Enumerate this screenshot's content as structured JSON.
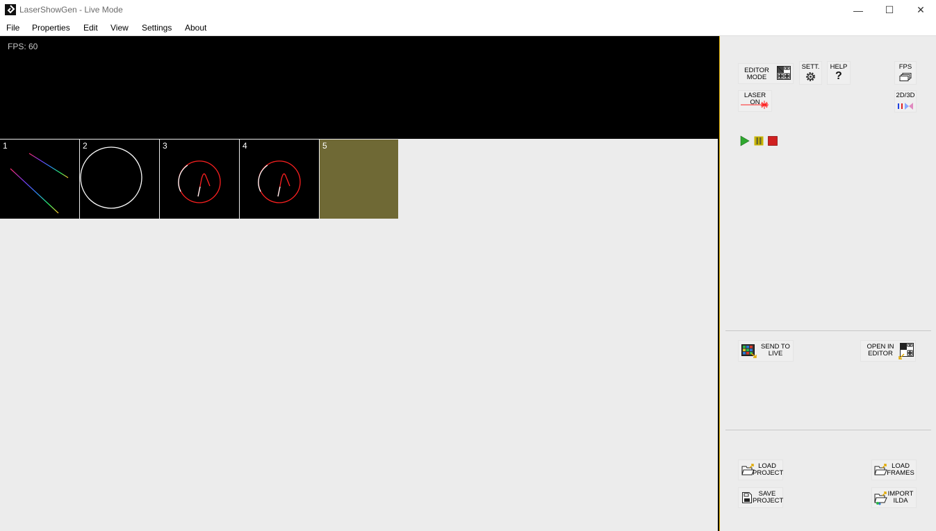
{
  "window": {
    "title": "LaserShowGen - Live Mode",
    "minimize_glyph": "—",
    "maximize_glyph": "☐",
    "close_glyph": "✕"
  },
  "menu": [
    "File",
    "Properties",
    "Edit",
    "View",
    "Settings",
    "About"
  ],
  "preview": {
    "fps_label": "FPS: 60"
  },
  "frames": [
    {
      "number": "1",
      "selected": false
    },
    {
      "number": "2",
      "selected": false
    },
    {
      "number": "3",
      "selected": false
    },
    {
      "number": "4",
      "selected": false
    },
    {
      "number": "5",
      "selected": true
    }
  ],
  "controls": {
    "editor_mode": {
      "line1": "EDITOR",
      "line2": "MODE"
    },
    "settings": "SETT.",
    "help": "HELP",
    "fps": "FPS",
    "laser_on": "LASER ON",
    "view_2d3d": "2D/3D",
    "send_to_live": {
      "line1": "SEND TO",
      "line2": "LIVE"
    },
    "open_in_editor": {
      "line1": "OPEN IN",
      "line2": "EDITOR"
    },
    "load_project": {
      "line1": "LOAD",
      "line2": "PROJECT"
    },
    "load_frames": {
      "line1": "LOAD",
      "line2": "FRAMES"
    },
    "save_project": {
      "line1": "SAVE",
      "line2": "PROJECT"
    },
    "import_ilda": {
      "line1": "IMPORT",
      "line2": "ILDA"
    }
  },
  "colors": {
    "selected_frame": "#6f6935",
    "divider_accent": "#e0b000",
    "play": "#2fa82f",
    "pause": "#c8b400",
    "stop": "#d02020",
    "laser": "#ff2020"
  }
}
